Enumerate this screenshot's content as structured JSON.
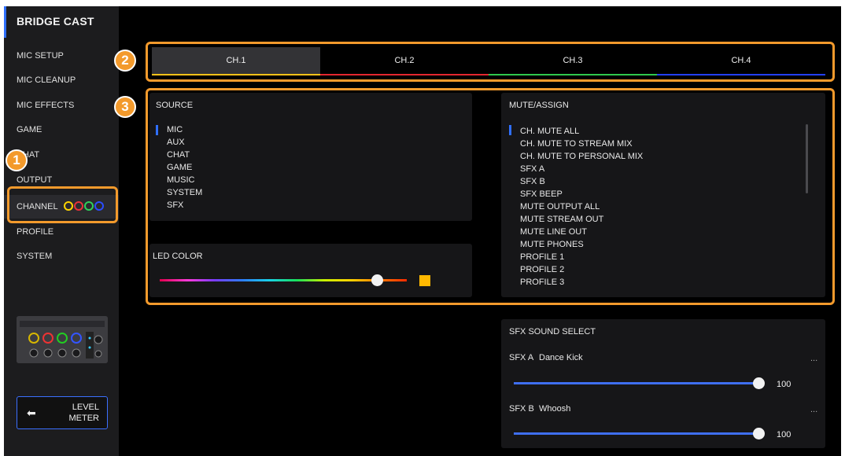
{
  "app": {
    "title": "BRIDGE CAST"
  },
  "sidebar": {
    "items": [
      {
        "label": "MIC SETUP"
      },
      {
        "label": "MIC CLEANUP"
      },
      {
        "label": "MIC EFFECTS"
      },
      {
        "label": "GAME"
      },
      {
        "label": "CHAT"
      },
      {
        "label": "OUTPUT"
      },
      {
        "label": "CHANNEL"
      },
      {
        "label": "PROFILE"
      },
      {
        "label": "SYSTEM"
      }
    ],
    "active": "CHANNEL",
    "channel_ring_colors": [
      "#ffd400",
      "#e8313a",
      "#2fd05a",
      "#2a4dff"
    ],
    "level_meter_button": {
      "line1": "LEVEL",
      "line2": "METER",
      "icon": "arrow-left-icon"
    }
  },
  "tabs": [
    {
      "label": "CH.1",
      "color": "#ffc21a"
    },
    {
      "label": "CH.2",
      "color": "#e3262f"
    },
    {
      "label": "CH.3",
      "color": "#2fc84d"
    },
    {
      "label": "CH.4",
      "color": "#2340ff"
    }
  ],
  "active_tab": "CH.1",
  "source": {
    "title": "SOURCE",
    "items": [
      "MIC",
      "AUX",
      "CHAT",
      "GAME",
      "MUSIC",
      "SYSTEM",
      "SFX"
    ],
    "selected": "MIC"
  },
  "led_color": {
    "title": "LED COLOR",
    "position_fraction": 0.88,
    "swatch_color": "#ffb800"
  },
  "mute_assign": {
    "title": "MUTE/ASSIGN",
    "items": [
      "CH. MUTE ALL",
      "CH. MUTE TO STREAM MIX",
      "CH. MUTE TO PERSONAL MIX",
      "SFX A",
      "SFX B",
      "SFX BEEP",
      "MUTE OUTPUT ALL",
      "MUTE STREAM OUT",
      "MUTE LINE OUT",
      "MUTE PHONES",
      "PROFILE 1",
      "PROFILE 2",
      "PROFILE 3"
    ],
    "selected": "CH. MUTE ALL"
  },
  "sfx_sound_select": {
    "title": "SFX SOUND SELECT",
    "rows": [
      {
        "slot": "SFX A",
        "sound": "Dance Kick",
        "more": "...",
        "value": "100"
      },
      {
        "slot": "SFX B",
        "sound": "Whoosh",
        "more": "...",
        "value": "100"
      }
    ]
  },
  "annotations": [
    "1",
    "2",
    "3"
  ],
  "accent_colors": {
    "highlight": "#f39a2c",
    "selection": "#2f6fff"
  }
}
